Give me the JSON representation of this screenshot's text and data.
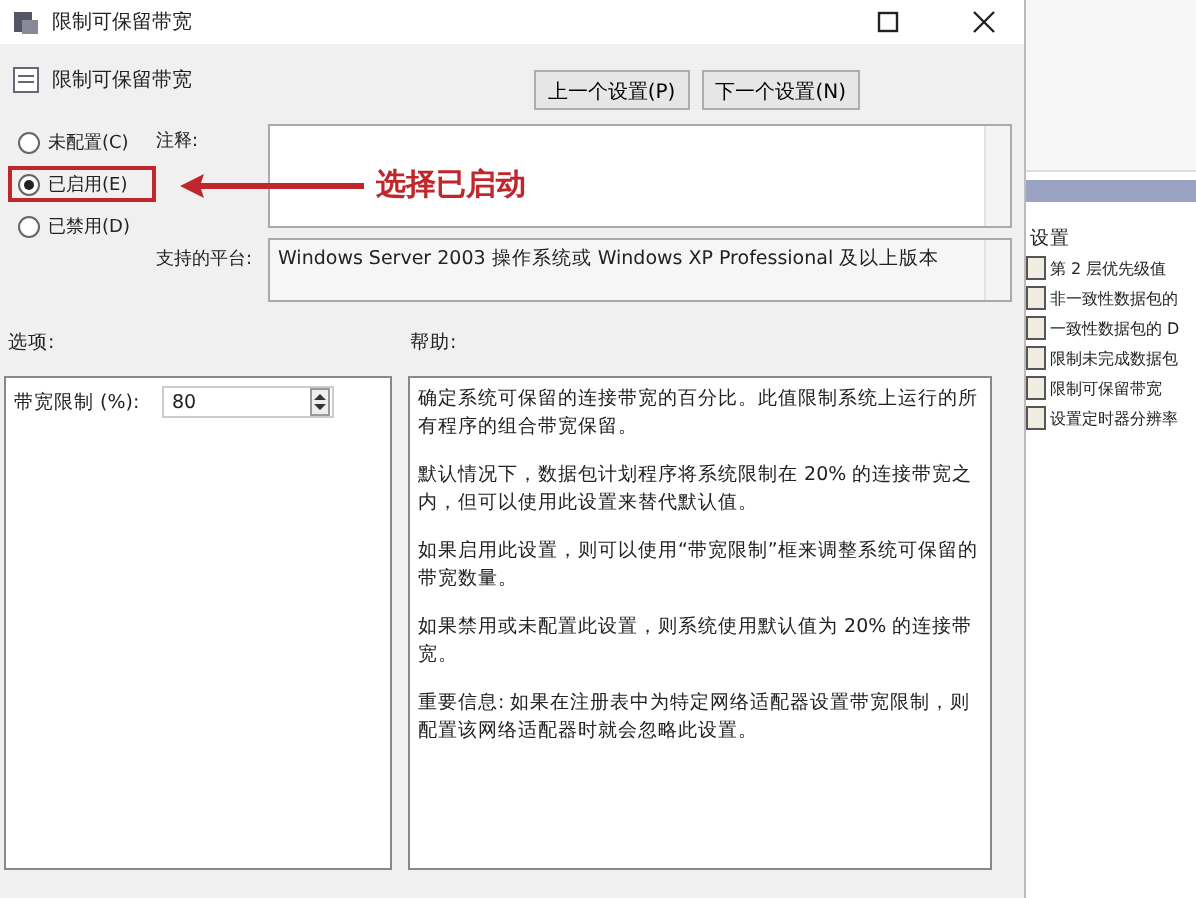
{
  "window": {
    "title": "限制可保留带宽"
  },
  "header": {
    "setting_name": "限制可保留带宽",
    "buttons": [
      "上一个设置(P)",
      "下一个设置(N)"
    ]
  },
  "state_options": [
    {
      "label": "未配置(C)",
      "selected": false
    },
    {
      "label": "已启用(E)",
      "selected": true
    },
    {
      "label": "已禁用(D)",
      "selected": false
    }
  ],
  "comment": {
    "label": "注释:"
  },
  "supported_on": {
    "label": "支持的平台:",
    "value": "Windows Server 2003 操作系统或 Windows XP Professional 及以上版本"
  },
  "options": {
    "label": "选项:",
    "fields": [
      {
        "label": "带宽限制 (%):",
        "value": "80"
      }
    ]
  },
  "help": {
    "label": "帮助:",
    "paragraphs": [
      "确定系统可保留的连接带宽的百分比。此值限制系统上运行的所有程序的组合带宽保留。",
      "默认情况下，数据包计划程序将系统限制在 20% 的连接带宽之内，但可以使用此设置来替代默认值。",
      "如果启用此设置，则可以使用“带宽限制”框来调整系统可保留的带宽数量。",
      "如果禁用或未配置此设置，则系统使用默认值为 20% 的连接带宽。",
      "重要信息: 如果在注册表中为特定网络适配器设置带宽限制，则配置该网络适配器时就会忽略此设置。"
    ]
  },
  "annotation": {
    "text": "选择已启动"
  },
  "background_window": {
    "column_label": "设置",
    "items": [
      "第 2 层优先级值",
      "非一致性数据包的",
      "一致性数据包的 D",
      "限制未完成数据包",
      "限制可保留带宽",
      "设置定时器分辨率"
    ]
  }
}
